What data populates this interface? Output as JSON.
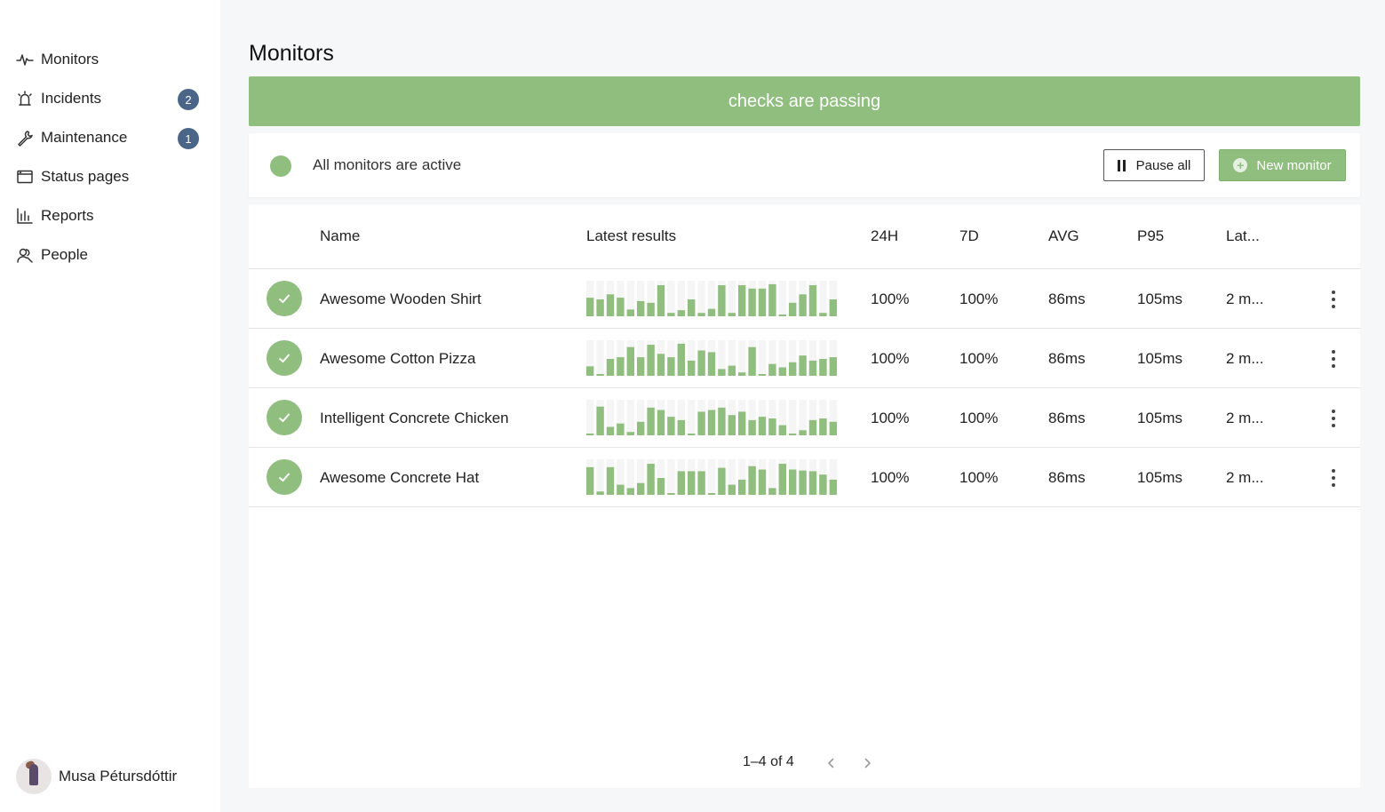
{
  "sidebar": {
    "items": [
      {
        "label": "Monitors",
        "icon": "pulse-icon"
      },
      {
        "label": "Incidents",
        "icon": "alarm-icon",
        "badge": "2"
      },
      {
        "label": "Maintenance",
        "icon": "wrench-icon",
        "badge": "1"
      },
      {
        "label": "Status pages",
        "icon": "browser-window-icon"
      },
      {
        "label": "Reports",
        "icon": "bar-chart-icon"
      },
      {
        "label": "People",
        "icon": "people-icon"
      }
    ],
    "user": {
      "name": "Musa Pétursdóttir"
    }
  },
  "page": {
    "title": "Monitors",
    "banner": "checks are passing"
  },
  "status": {
    "text": "All monitors are active",
    "pause_label": "Pause all",
    "new_label": "New monitor"
  },
  "table": {
    "headers": {
      "name": "Name",
      "latest": "Latest results",
      "h24": "24H",
      "d7": "7D",
      "avg": "AVG",
      "p95": "P95",
      "last": "Lat..."
    },
    "rows": [
      {
        "name": "Awesome Wooden Shirt",
        "h24": "100%",
        "d7": "100%",
        "avg": "86ms",
        "p95": "105ms",
        "last": "2 m...",
        "results": [
          0.55,
          0.5,
          0.65,
          0.55,
          0.2,
          0.45,
          0.4,
          0.92,
          0.1,
          0.18,
          0.5,
          0.1,
          0.22,
          0.92,
          0.1,
          0.92,
          0.82,
          0.82,
          0.95,
          0.05,
          0.4,
          0.65,
          0.92,
          0.1,
          0.5
        ]
      },
      {
        "name": "Awesome Cotton Pizza",
        "h24": "100%",
        "d7": "100%",
        "avg": "86ms",
        "p95": "105ms",
        "last": "2 m...",
        "results": [
          0.28,
          0.05,
          0.5,
          0.55,
          0.85,
          0.55,
          0.92,
          0.65,
          0.55,
          0.95,
          0.45,
          0.75,
          0.7,
          0.2,
          0.3,
          0.1,
          0.85,
          0.05,
          0.35,
          0.25,
          0.4,
          0.6,
          0.45,
          0.5,
          0.55
        ]
      },
      {
        "name": "Intelligent Concrete Chicken",
        "h24": "100%",
        "d7": "100%",
        "avg": "86ms",
        "p95": "105ms",
        "last": "2 m...",
        "results": [
          0.05,
          0.85,
          0.25,
          0.35,
          0.1,
          0.4,
          0.82,
          0.75,
          0.55,
          0.45,
          0.05,
          0.7,
          0.75,
          0.82,
          0.6,
          0.7,
          0.45,
          0.55,
          0.5,
          0.3,
          0.05,
          0.15,
          0.45,
          0.5,
          0.4
        ]
      },
      {
        "name": "Awesome Concrete Hat",
        "h24": "100%",
        "d7": "100%",
        "avg": "86ms",
        "p95": "105ms",
        "last": "2 m...",
        "results": [
          0.82,
          0.1,
          0.82,
          0.3,
          0.2,
          0.35,
          0.92,
          0.5,
          0.05,
          0.7,
          0.7,
          0.7,
          0.05,
          0.8,
          0.3,
          0.45,
          0.85,
          0.75,
          0.2,
          0.92,
          0.75,
          0.72,
          0.7,
          0.6,
          0.45
        ]
      }
    ]
  },
  "pagination": {
    "text": "1–4 of 4"
  },
  "colors": {
    "success": "#8fbe7e",
    "badge": "#4a6588"
  }
}
